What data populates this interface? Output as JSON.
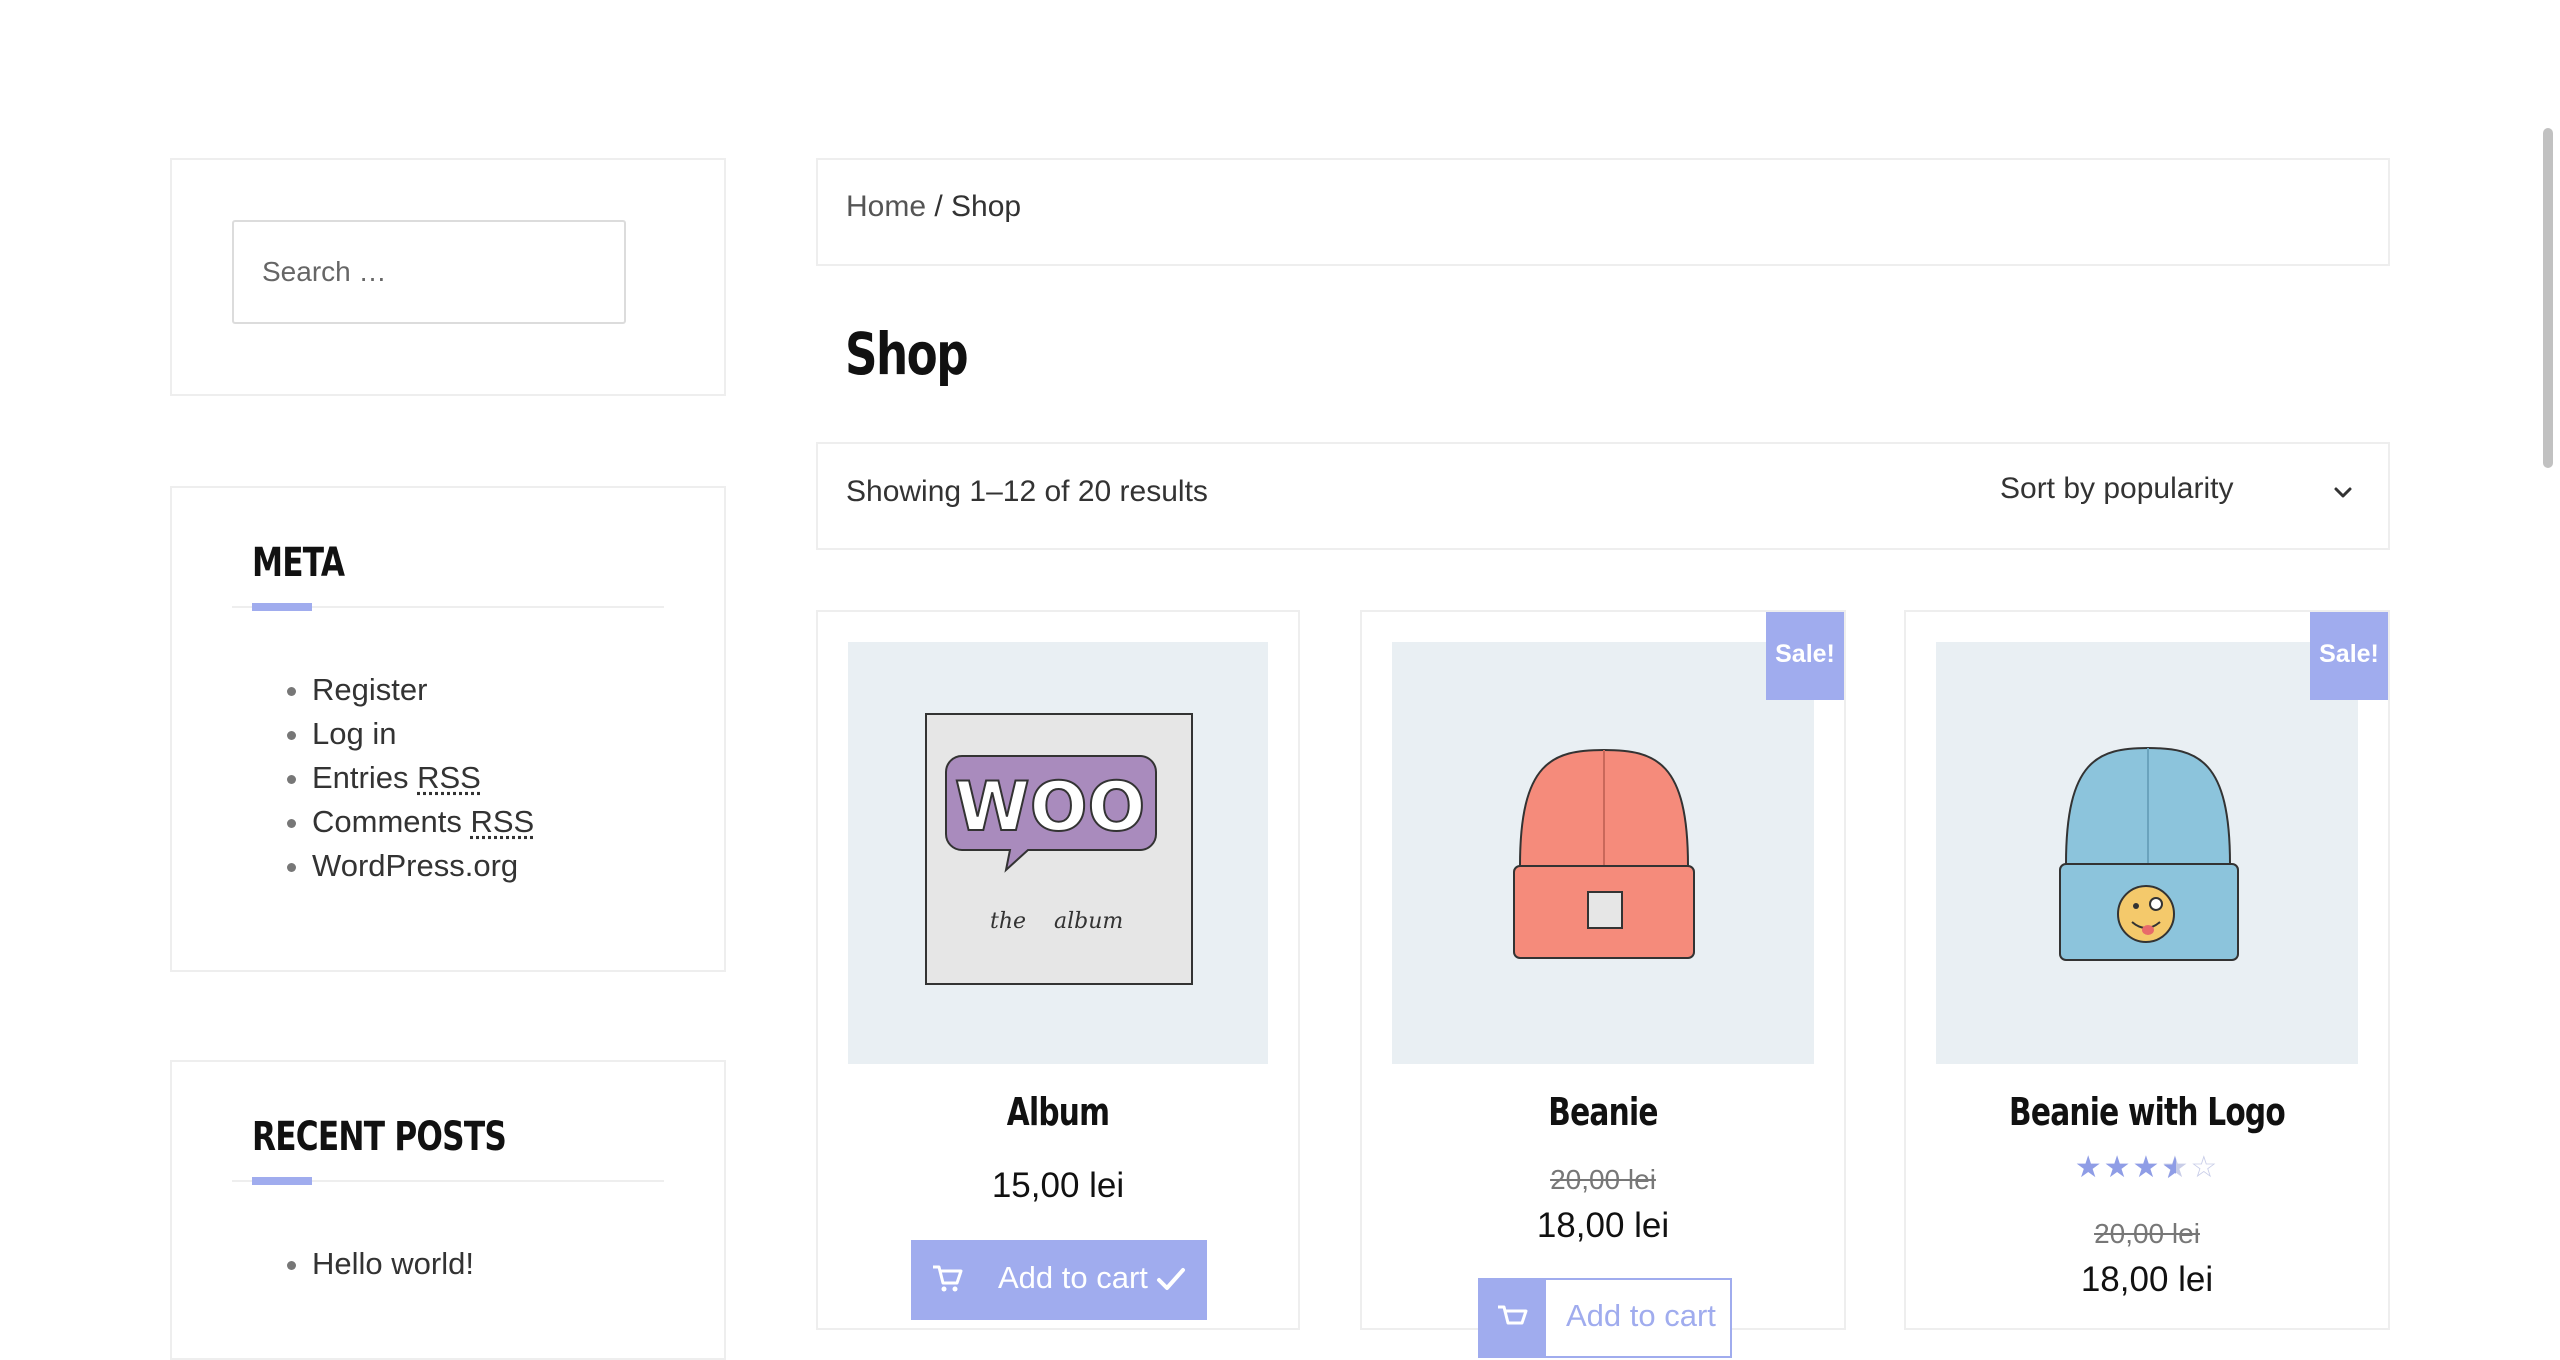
{
  "search": {
    "placeholder": "Search …"
  },
  "meta_widget": {
    "title": "META",
    "items": [
      {
        "label": "Register"
      },
      {
        "label": "Log in"
      },
      {
        "label_prefix": "Entries ",
        "abbr": "RSS"
      },
      {
        "label_prefix": "Comments ",
        "abbr": "RSS"
      },
      {
        "label": "WordPress.org"
      }
    ]
  },
  "recent_posts": {
    "title": "RECENT POSTS",
    "items": [
      {
        "label": "Hello world!"
      }
    ]
  },
  "breadcrumb": {
    "home": "Home",
    "separator": " / ",
    "current": "Shop"
  },
  "page": {
    "title": "Shop"
  },
  "toolbar": {
    "result_count": "Showing 1–12 of 20 results",
    "sort_selected": "Sort by popularity"
  },
  "products": [
    {
      "name": "Album",
      "price": "15,00 lei",
      "button": "Add to cart"
    },
    {
      "name": "Beanie",
      "badge": "Sale!",
      "old_price": "20,00 lei",
      "price": "18,00 lei",
      "button": "Add to cart"
    },
    {
      "name": "Beanie with Logo",
      "badge": "Sale!",
      "rating": 3.5,
      "rating_max": 5,
      "old_price": "20,00 lei",
      "price": "18,00 lei"
    }
  ],
  "album_art": {
    "logo_text": "WOO",
    "caption_left": "the",
    "caption_right": "album"
  },
  "colors": {
    "accent": "#a0acee",
    "beanie_orange": "#f58b7b",
    "beanie_blue": "#8cc4dc",
    "image_bg": "#e9eff3"
  }
}
